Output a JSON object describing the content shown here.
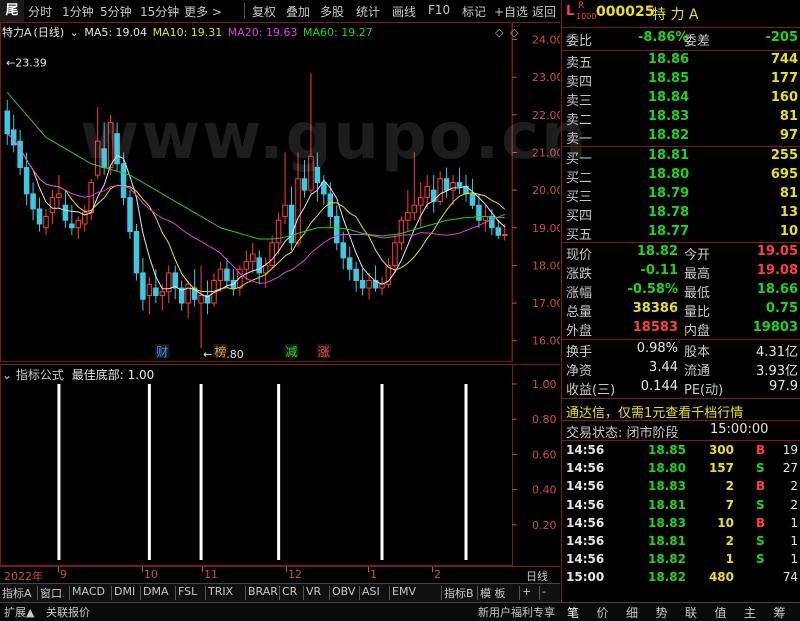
{
  "toolbar": {
    "logo": "尾",
    "items": [
      "分时",
      "1分钟",
      "5分钟",
      "15分钟",
      "更多 >",
      "复权",
      "叠加",
      "多股",
      "统计",
      "画线",
      "F10",
      "标记",
      "+自选",
      "返回"
    ]
  },
  "stock": {
    "name": "特力A",
    "code": "000025",
    "period": "(日线)",
    "marker_l": "L",
    "marker_r": "R",
    "marker_sub": "1000"
  },
  "ma": {
    "ma5": "MA5: 19.04",
    "ma10": "MA10: 19.31",
    "ma20": "MA20: 19.63",
    "ma60": "MA60: 19.27",
    "colors": {
      "ma5": "#e6e6e6",
      "ma10": "#e8e020",
      "ma20": "#e040e0",
      "ma60": "#21d321"
    }
  },
  "watermark": "www.gupo.cn",
  "price_axis": [
    "24.00",
    "23.00",
    "22.00",
    "21.00",
    "20.00",
    "19.00",
    "18.00",
    "17.00",
    "16.00"
  ],
  "annotations": {
    "high": "23.39",
    "low": "15.80"
  },
  "event_tags": [
    "财",
    "榜",
    "减",
    "涨"
  ],
  "indicator": {
    "title": "指标公式",
    "formula": "最佳底部: 1.00",
    "axis": [
      "1.00",
      "0.80",
      "0.60",
      "0.40",
      "0.20"
    ]
  },
  "dates": [
    "2022年",
    "9",
    "10",
    "11",
    "12",
    "1",
    "2",
    "日线"
  ],
  "indicator_tabs": [
    "指标A",
    "窗口",
    "MACD",
    "DMI",
    "DMA",
    "FSL",
    "TRIX",
    "BRAR",
    "CR",
    "VR",
    "OBV",
    "ASI",
    "EMV",
    "指标B",
    "模 板",
    "+",
    "-"
  ],
  "status_left": [
    "扩展▲",
    "关联报价"
  ],
  "status_right": "新用户福利专享",
  "header": {
    "code": "000025",
    "name": "特 力 A"
  },
  "weibi": {
    "label": "委比",
    "value": "-8.86%",
    "label2": "委差",
    "value2": "-205"
  },
  "asks": [
    {
      "label": "卖五",
      "price": "18.86",
      "vol": "744"
    },
    {
      "label": "卖四",
      "price": "18.85",
      "vol": "177"
    },
    {
      "label": "卖三",
      "price": "18.84",
      "vol": "160"
    },
    {
      "label": "卖二",
      "price": "18.83",
      "vol": "81"
    },
    {
      "label": "卖一",
      "price": "18.82",
      "vol": "97"
    }
  ],
  "bids": [
    {
      "label": "买一",
      "price": "18.81",
      "vol": "255"
    },
    {
      "label": "买二",
      "price": "18.80",
      "vol": "695"
    },
    {
      "label": "买三",
      "price": "18.79",
      "vol": "81"
    },
    {
      "label": "买四",
      "price": "18.78",
      "vol": "13"
    },
    {
      "label": "买五",
      "price": "18.77",
      "vol": "10"
    }
  ],
  "quote": [
    {
      "l1": "现价",
      "v1": "18.82",
      "c1": "green",
      "l2": "今开",
      "v2": "19.05",
      "c2": "red"
    },
    {
      "l1": "涨跌",
      "v1": "-0.11",
      "c1": "green",
      "l2": "最高",
      "v2": "19.08",
      "c2": "red"
    },
    {
      "l1": "涨幅",
      "v1": "-0.58%",
      "c1": "green",
      "l2": "最低",
      "v2": "18.66",
      "c2": "green"
    },
    {
      "l1": "总量",
      "v1": "38386",
      "c1": "yellow",
      "l2": "量比",
      "v2": "0.75",
      "c2": "green"
    },
    {
      "l1": "外盘",
      "v1": "18583",
      "c1": "red",
      "l2": "内盘",
      "v2": "19803",
      "c2": "green"
    }
  ],
  "fund": [
    {
      "l1": "换手",
      "v1": "0.98%",
      "l2": "股本",
      "v2": "4.31亿"
    },
    {
      "l1": "净资",
      "v1": "3.44",
      "l2": "流通",
      "v2": "3.93亿"
    },
    {
      "l1": "收益(三)",
      "v1": "0.144",
      "l2": "PE(动)",
      "v2": "97.9"
    }
  ],
  "promo": "通达信，仅需1元查看千档行情",
  "trade_state": {
    "label": "交易状态: 闭市阶段",
    "time": "15:00:00"
  },
  "ticks": [
    {
      "time": "14:56",
      "price": "18.85",
      "vol": "300",
      "bs": "B",
      "n": "19"
    },
    {
      "time": "14:56",
      "price": "18.80",
      "vol": "157",
      "bs": "S",
      "n": "27"
    },
    {
      "time": "14:56",
      "price": "18.83",
      "vol": "2",
      "bs": "B",
      "n": "2"
    },
    {
      "time": "14:56",
      "price": "18.81",
      "vol": "7",
      "bs": "S",
      "n": "2"
    },
    {
      "time": "14:56",
      "price": "18.83",
      "vol": "10",
      "bs": "B",
      "n": "1"
    },
    {
      "time": "14:56",
      "price": "18.81",
      "vol": "2",
      "bs": "S",
      "n": "1"
    },
    {
      "time": "14:56",
      "price": "18.82",
      "vol": "1",
      "bs": "S",
      "n": "1"
    },
    {
      "time": "15:00",
      "price": "18.82",
      "vol": "480",
      "bs": "",
      "n": "74"
    }
  ],
  "bottom_tabs": [
    "笔",
    "价",
    "细",
    "势",
    "联",
    "值",
    "主",
    "筹"
  ],
  "chart_data": {
    "type": "candlestick",
    "ylim": [
      15.7,
      24.2
    ],
    "candles": [
      [
        22.1,
        22.4,
        21.2,
        21.5
      ],
      [
        21.6,
        22.0,
        21.0,
        21.2
      ],
      [
        21.3,
        21.6,
        20.4,
        20.6
      ],
      [
        20.6,
        21.0,
        19.6,
        19.9
      ],
      [
        19.9,
        20.2,
        19.2,
        19.5
      ],
      [
        19.5,
        19.8,
        18.9,
        19.1
      ],
      [
        19.0,
        19.5,
        18.8,
        19.3
      ],
      [
        19.4,
        20.0,
        19.1,
        19.8
      ],
      [
        19.8,
        20.4,
        19.5,
        19.9
      ],
      [
        19.6,
        20.0,
        19.0,
        19.2
      ],
      [
        19.1,
        19.6,
        18.8,
        19.0
      ],
      [
        19.0,
        19.3,
        18.7,
        19.2
      ],
      [
        19.1,
        19.6,
        18.9,
        19.4
      ],
      [
        19.4,
        20.3,
        19.2,
        20.2
      ],
      [
        20.4,
        22.2,
        20.3,
        21.3
      ],
      [
        21.1,
        21.8,
        20.4,
        20.6
      ],
      [
        20.6,
        22.0,
        20.4,
        21.8
      ],
      [
        21.5,
        21.8,
        20.5,
        20.7
      ],
      [
        20.7,
        21.0,
        19.6,
        19.8
      ],
      [
        19.8,
        20.0,
        18.7,
        18.9
      ],
      [
        18.9,
        19.1,
        17.6,
        17.8
      ],
      [
        17.8,
        18.2,
        16.8,
        17.1
      ],
      [
        17.2,
        17.7,
        16.7,
        17.5
      ],
      [
        17.4,
        17.9,
        17.0,
        17.2
      ],
      [
        17.2,
        17.5,
        16.8,
        17.3
      ],
      [
        17.3,
        18.0,
        17.0,
        17.8
      ],
      [
        17.8,
        18.0,
        17.1,
        17.4
      ],
      [
        17.4,
        17.6,
        16.8,
        17.0
      ],
      [
        17.0,
        17.6,
        16.6,
        17.5
      ],
      [
        17.4,
        17.9,
        16.9,
        17.1
      ],
      [
        17.0,
        18.0,
        15.8,
        17.2
      ],
      [
        17.2,
        17.6,
        16.7,
        17.0
      ],
      [
        17.0,
        17.8,
        16.9,
        17.6
      ],
      [
        17.6,
        18.1,
        17.3,
        17.9
      ],
      [
        17.9,
        18.2,
        17.4,
        17.6
      ],
      [
        17.6,
        17.9,
        17.2,
        17.4
      ],
      [
        17.4,
        18.0,
        17.2,
        17.9
      ],
      [
        17.9,
        18.4,
        17.6,
        18.1
      ],
      [
        18.1,
        18.6,
        17.8,
        18.3
      ],
      [
        18.2,
        18.4,
        17.5,
        17.8
      ],
      [
        17.8,
        18.2,
        17.4,
        18.0
      ],
      [
        18.0,
        18.8,
        17.9,
        18.6
      ],
      [
        18.6,
        19.4,
        18.3,
        19.2
      ],
      [
        19.3,
        21.0,
        19.1,
        19.6
      ],
      [
        19.6,
        20.1,
        18.4,
        18.6
      ],
      [
        18.6,
        21.0,
        18.5,
        20.3
      ],
      [
        20.3,
        20.8,
        19.8,
        20.0
      ],
      [
        20.0,
        23.1,
        19.9,
        20.9
      ],
      [
        20.6,
        21.0,
        19.7,
        20.2
      ],
      [
        20.2,
        20.4,
        19.6,
        19.9
      ],
      [
        19.9,
        20.2,
        19.0,
        19.3
      ],
      [
        19.3,
        19.6,
        18.4,
        18.6
      ],
      [
        18.6,
        18.9,
        17.9,
        18.2
      ],
      [
        18.2,
        18.5,
        17.6,
        17.9
      ],
      [
        17.9,
        18.1,
        17.3,
        17.6
      ],
      [
        17.6,
        17.9,
        17.2,
        17.4
      ],
      [
        17.4,
        17.8,
        17.1,
        17.6
      ],
      [
        17.6,
        18.0,
        17.3,
        17.4
      ],
      [
        17.4,
        17.7,
        17.2,
        17.5
      ],
      [
        17.5,
        18.2,
        17.4,
        18.0
      ],
      [
        18.0,
        18.8,
        17.8,
        18.6
      ],
      [
        18.6,
        19.3,
        18.4,
        19.2
      ],
      [
        19.2,
        20.0,
        18.9,
        19.4
      ],
      [
        19.4,
        21.0,
        19.2,
        19.6
      ],
      [
        19.6,
        20.2,
        19.0,
        19.8
      ],
      [
        19.8,
        20.4,
        19.5,
        20.1
      ],
      [
        20.0,
        20.4,
        19.4,
        19.7
      ],
      [
        19.7,
        20.5,
        19.6,
        20.3
      ],
      [
        20.3,
        20.6,
        19.8,
        20.0
      ],
      [
        20.0,
        20.4,
        19.6,
        20.2
      ],
      [
        20.2,
        20.6,
        19.9,
        20.1
      ],
      [
        20.1,
        20.4,
        19.7,
        19.9
      ],
      [
        19.9,
        20.3,
        19.5,
        19.6
      ],
      [
        19.6,
        19.9,
        19.0,
        19.2
      ],
      [
        19.2,
        19.6,
        18.9,
        19.3
      ],
      [
        19.3,
        19.5,
        18.8,
        19.0
      ],
      [
        19.0,
        19.2,
        18.7,
        18.8
      ],
      [
        18.8,
        19.1,
        18.66,
        18.82
      ]
    ],
    "ma60": [
      22.6,
      22.4,
      22.2,
      22.0,
      21.8,
      21.6,
      21.4,
      21.3,
      21.2,
      21.1,
      21.0,
      20.9,
      20.8,
      20.7,
      20.65,
      20.6,
      20.55,
      20.5,
      20.45,
      20.4,
      20.3,
      20.2,
      20.1,
      20.0,
      19.9,
      19.8,
      19.7,
      19.6,
      19.5,
      19.4,
      19.3,
      19.2,
      19.1,
      19.0,
      18.95,
      18.9,
      18.85,
      18.8,
      18.75,
      18.7,
      18.7,
      18.7,
      18.72,
      18.75,
      18.8,
      18.85,
      18.9,
      18.95,
      19.0,
      19.0,
      19.0,
      19.0,
      18.98,
      18.95,
      18.9,
      18.85,
      18.82,
      18.8,
      18.78,
      18.8,
      18.82,
      18.85,
      18.9,
      18.95,
      19.0,
      19.05,
      19.1,
      19.15,
      19.2,
      19.22,
      19.25,
      19.27,
      19.28,
      19.3,
      19.3,
      19.28,
      19.27,
      19.27
    ],
    "signals": [
      8,
      22,
      30,
      42,
      58,
      71
    ]
  }
}
